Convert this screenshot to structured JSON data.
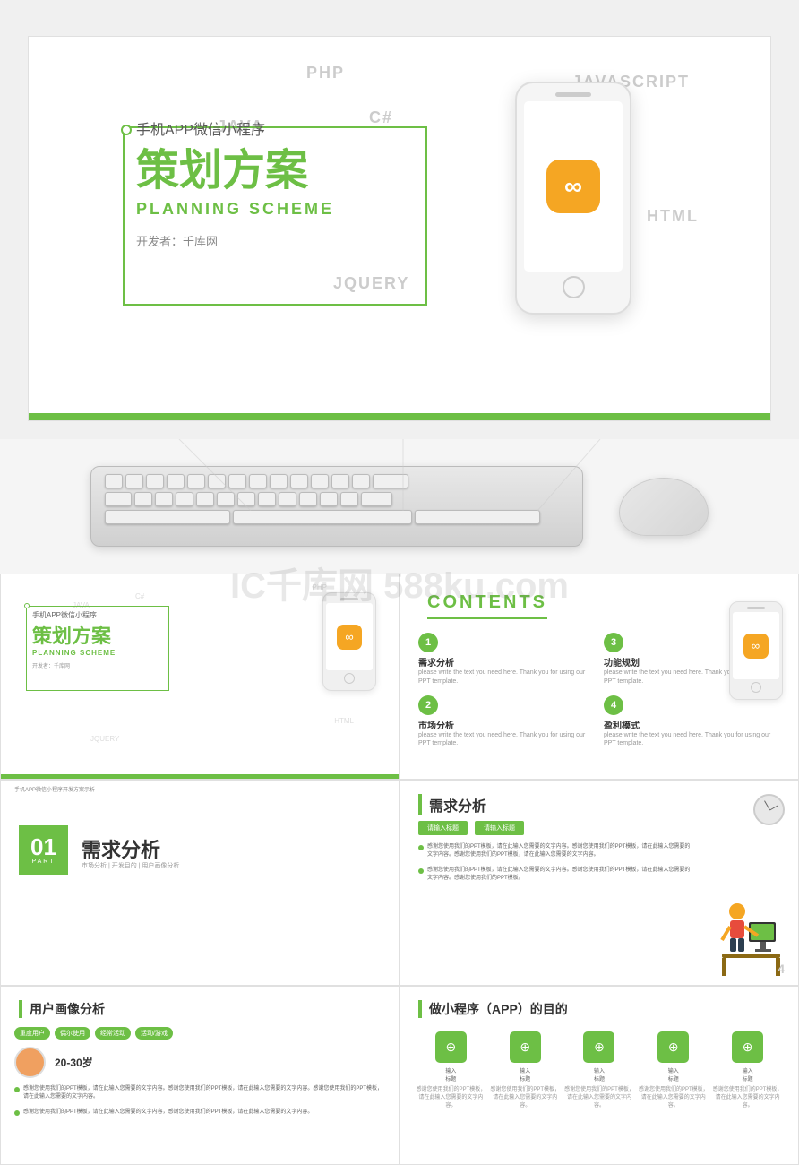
{
  "slide1": {
    "subtitle": "手机APP微信小程序",
    "title": "策划方案",
    "title_en": "PLANNING SCHEME",
    "developer": "开发者：千库网",
    "tech_labels": {
      "php": "PHP",
      "javascript": "JAVASCRIPT",
      "java": "JAVA",
      "csharp": "C#",
      "html": "HTML",
      "jquery": "JQUERY"
    }
  },
  "slide2_contents": {
    "title": "CONTENTS",
    "items": [
      {
        "num": "1",
        "title": "需求分析",
        "text": "please write the text you need here. Thank you for using our PPT template."
      },
      {
        "num": "3",
        "title": "功能规划",
        "text": "please write the text you need here. Thank you for using our PPT template."
      },
      {
        "num": "2",
        "title": "市场分析",
        "text": "please write the text you need here. Thank you for using our PPT template."
      },
      {
        "num": "4",
        "title": "盈利模式",
        "text": "please write the text you need here. Thank you for using our PPT template."
      }
    ]
  },
  "slide3_demand": {
    "page_title": "手机APP微信小程序开发方案示析",
    "number": "01",
    "part": "PART",
    "title": "需求分析",
    "subtitle": "市场分析 | 开发目的 | 用户画像分析"
  },
  "slide4_detail": {
    "title": "需求分析",
    "btn1": "请输入标题",
    "btn2": "请输入标题",
    "bullet1": "感谢您使用我们的PPT模板，请在此输入您需要的文字内容。感谢您使用我们的PPT模板，请在此输入您需要的文字内容。感谢您使用我们的PPT模板，请在此输入您需要的文字内容。",
    "bullet2": "感谢您使用我们的PPT模板，请在此输入您需要的文字内容。感谢您使用我们的PPT模板，请在此输入您需要的文字内容。感谢您使用我们的PPT模板。",
    "page_num": "4"
  },
  "slide5_portrait": {
    "title": "用户画像分析",
    "age": "20-30岁",
    "tags": [
      "重度用户",
      "偶尔使用",
      "经常活动",
      "活动/游戏"
    ],
    "text1": "感谢您使用我们的PPT模板，请在此输入您需要的文字内容。感谢您使用我们的PPT模板，请在此输入您需要的文字内容。感谢您使用我们的PPT模板，请在此输入您需要的文字内容。",
    "text2": "感谢您使用我们的PPT模板，请在此输入您需要的文字内容，感谢您使用我们的PPT模板，请在此输入您需要的文字内容。"
  },
  "slide6_miniapp": {
    "title": "做小程序（APP）的目的",
    "items": [
      {
        "icon": "⊕",
        "label": "输入\n标题",
        "desc": "感谢您使用我们的PPT模板，请在此输入您需要的文字内容。"
      },
      {
        "icon": "⊕",
        "label": "输入\n标题",
        "desc": "感谢您使用我们的PPT模板，请在此输入您需要的文字内容。"
      },
      {
        "icon": "⊕",
        "label": "输入\n标题",
        "desc": "感谢您使用我们的PPT模板，请在此输入您需要的文字内容。"
      },
      {
        "icon": "⊕",
        "label": "输入\n标题",
        "desc": "感谢您使用我们的PPT模板，请在此输入您需要的文字内容。"
      },
      {
        "icon": "⊕",
        "label": "输入\n标题",
        "desc": "感谢您使用我们的PPT模板，请在此输入您需要的文字内容。"
      }
    ]
  },
  "watermark": "IC千库网 588ku.com",
  "colors": {
    "green": "#6dbf45",
    "orange": "#f5a623",
    "light_gray": "#f5f5f5"
  }
}
